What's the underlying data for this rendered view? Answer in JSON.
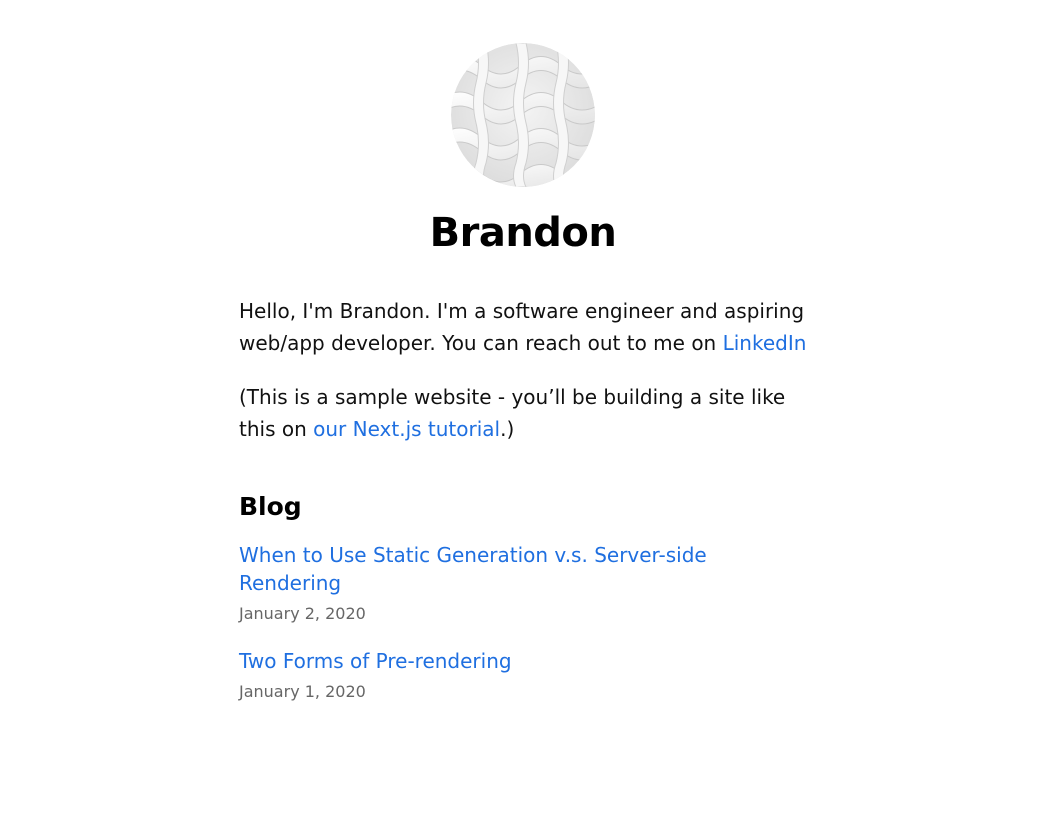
{
  "profile": {
    "name": "Brandon",
    "avatar_icon": "profile-image"
  },
  "intro": {
    "text1": "Hello, I'm Brandon. I'm a software engineer and aspiring web/app developer. You can reach out to me on ",
    "link1": "LinkedIn",
    "text2": "(This is a sample website - you’ll be building a site like this on ",
    "link2": "our Next.js tutorial",
    "text2_end": ".)"
  },
  "blog": {
    "heading": "Blog",
    "posts": [
      {
        "title": "When to Use Static Generation v.s. Server-side Rendering",
        "date": "January 2, 2020"
      },
      {
        "title": "Two Forms of Pre-rendering",
        "date": "January 1, 2020"
      }
    ]
  },
  "colors": {
    "link": "#1f6fe0",
    "muted": "#666666",
    "text": "#111111"
  }
}
